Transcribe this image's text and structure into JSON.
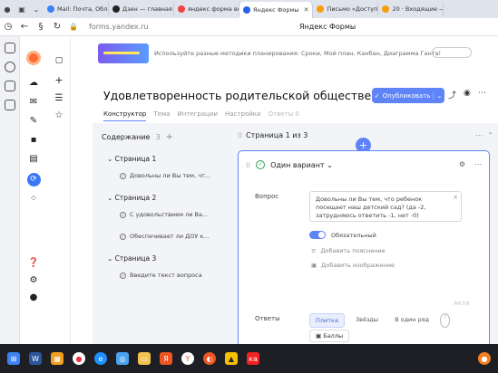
{
  "browser": {
    "tabs": [
      {
        "label": "Mail: Почта, Обла",
        "color": "#3b82f6"
      },
      {
        "label": "Дзен — главная н",
        "color": "#222222"
      },
      {
        "label": "яндекс форма вой",
        "color": "#ef4444"
      },
      {
        "label": "Яндекс Формы",
        "color": "#2563eb",
        "active": true
      },
      {
        "label": "Письмо «Доступ к",
        "color": "#f59e0b"
      },
      {
        "label": "20 · Входящие —",
        "color": "#f59e0b"
      }
    ],
    "url": "forms.yandex.ru",
    "page_title": "Яндекс Формы"
  },
  "banner": {
    "text": "Используйте разные методики планирования: Сроки, Мой план, Канбан, Диаграмма Ганта!"
  },
  "form": {
    "title": "Удовлетворенность родительской общественности",
    "publish_label": "Опубликовать",
    "tabs": [
      "Конструктор",
      "Тема",
      "Интеграции",
      "Настройки",
      "Ответы 0"
    ]
  },
  "outline": {
    "title": "Содержание",
    "count": "3",
    "pages": [
      {
        "label": "Страница 1",
        "questions": [
          "Довольны ли Вы тем, чт..."
        ]
      },
      {
        "label": "Страница 2",
        "questions": [
          "С удовольствием ли Ва...",
          "Обеспечивает ли ДОУ к..."
        ]
      },
      {
        "label": "Страница 3",
        "questions": [
          "Введите текст вопроса"
        ]
      }
    ]
  },
  "page_panel": {
    "title": "Страница 1 из 3",
    "question": {
      "type": "Один вариант",
      "label_question": "Вопрос",
      "text": "Довольны ли Вы тем, что ребенок посещает наш детский сад? (да -2, затрудняюсь ответить -1, нет -0)",
      "required_label": "Обязательный",
      "add_hint": "Добавить пояснение",
      "add_image": "Добавить изображение",
      "label_answers": "Ответы",
      "answer_modes": [
        "Плитка",
        "Звёзды",
        "В один ряд"
      ],
      "score_label": "Баллы",
      "score_value": "0"
    }
  },
  "watermark": "Акти"
}
